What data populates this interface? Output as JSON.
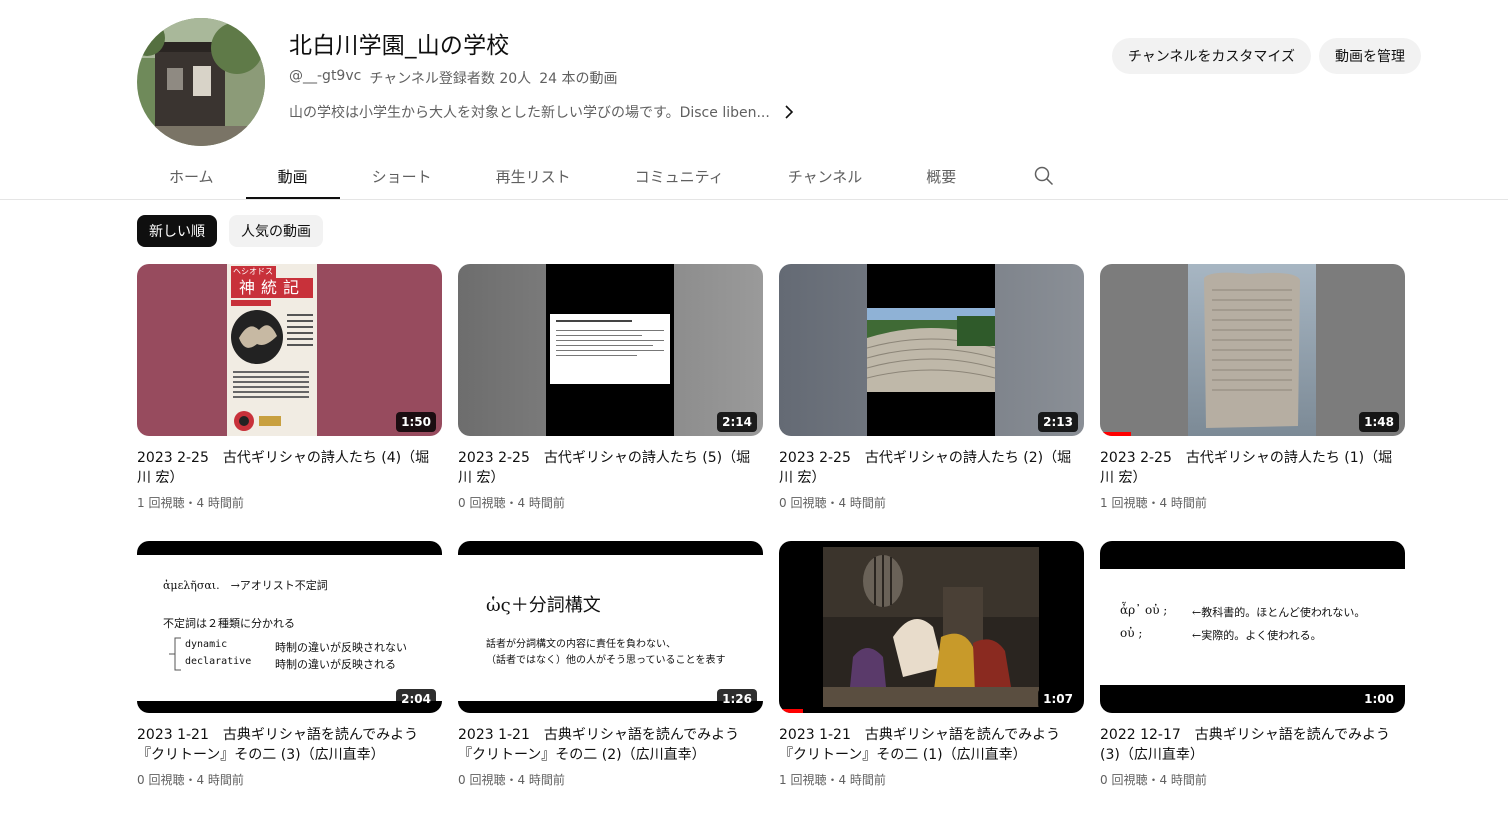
{
  "channel": {
    "title": "北白川学園_山の学校",
    "handle": "@__-gt9vc",
    "subscribers": "チャンネル登録者数 20人",
    "video_count": "24 本の動画",
    "description": "山の学校は小学生から大人を対象とした新しい学びの場です。Disce liben..."
  },
  "actions": {
    "customize": "チャンネルをカスタマイズ",
    "manage": "動画を管理"
  },
  "tabs": [
    {
      "label": "ホーム"
    },
    {
      "label": "動画"
    },
    {
      "label": "ショート"
    },
    {
      "label": "再生リスト"
    },
    {
      "label": "コミュニティ"
    },
    {
      "label": "チャンネル"
    },
    {
      "label": "概要"
    }
  ],
  "chips": [
    {
      "label": "新しい順"
    },
    {
      "label": "人気の動画"
    }
  ],
  "videos": [
    {
      "title": "2023 2-25　古代ギリシャの詩人たち (4)（堀川 宏）",
      "meta": "1 回視聴・4 時間前",
      "duration": "1:50",
      "progress": 0
    },
    {
      "title": "2023 2-25　古代ギリシャの詩人たち (5)（堀川 宏）",
      "meta": "0 回視聴・4 時間前",
      "duration": "2:14",
      "progress": 0
    },
    {
      "title": "2023 2-25　古代ギリシャの詩人たち (2)（堀川 宏）",
      "meta": "0 回視聴・4 時間前",
      "duration": "2:13",
      "progress": 0
    },
    {
      "title": "2023 2-25　古代ギリシャの詩人たち (1)（堀川 宏）",
      "meta": "1 回視聴・4 時間前",
      "duration": "1:48",
      "progress": 0.1
    },
    {
      "title": "2023 1-21　古典ギリシャ語を読んでみよう『クリトーン』その二 (3)（広川直幸）",
      "meta": "0 回視聴・4 時間前",
      "duration": "2:04",
      "progress": 0
    },
    {
      "title": "2023 1-21　古典ギリシャ語を読んでみよう『クリトーン』その二 (2)（広川直幸）",
      "meta": "0 回視聴・4 時間前",
      "duration": "1:26",
      "progress": 0
    },
    {
      "title": "2023 1-21　古典ギリシャ語を読んでみよう『クリトーン』その二 (1)（広川直幸）",
      "meta": "1 回視聴・4 時間前",
      "duration": "1:07",
      "progress": 0.08
    },
    {
      "title": "2022 12-17　古典ギリシャ語を読んでみよう (3)（広川直幸）",
      "meta": "0 回視聴・4 時間前",
      "duration": "1:00",
      "progress": 0
    }
  ],
  "thumb_text": {
    "book_label": "ヘシオドス",
    "book_title": "神統記",
    "slide5_line1": "ἀμελῆσαι.　→アオリスト不定詞",
    "slide5_line2": "不定詞は２種類に分かれる",
    "slide5_a_term": "dynamic",
    "slide5_a_desc": "時制の違いが反映されない",
    "slide5_b_term": "declarative",
    "slide5_b_desc": "時制の違いが反映される",
    "slide6_title": "ὡς＋分詞構文",
    "slide6_line1": "話者が分詞構文の内容に責任を負わない、",
    "slide6_line2": "（話者ではなく）他の人がそう思っていることを表す",
    "slide8_a_greek": "ἆρ᾽ οὐ ;",
    "slide8_a_desc": "←教科書的。ほとんど使われない。",
    "slide8_b_greek": "οὐ ;",
    "slide8_b_desc": "←実際的。よく使われる。"
  },
  "colors": {
    "accent_red": "#ff0000",
    "text_primary": "#0f0f0f",
    "text_secondary": "#606060",
    "chip_bg": "#f2f2f2"
  }
}
